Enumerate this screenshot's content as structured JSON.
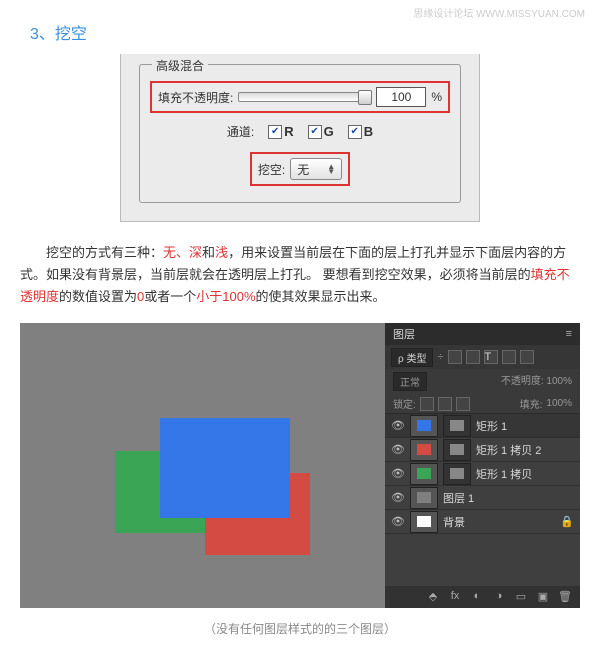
{
  "watermark": "思缘设计论坛  WWW.MISSYUAN.COM",
  "title": "3、挖空",
  "fig1": {
    "legend": "高级混合",
    "fillLabel": "填充不透明度:",
    "fillValue": "100",
    "pct": "%",
    "channelLabel": "通道:",
    "chR": "R",
    "chG": "G",
    "chB": "B",
    "knockoutLabel": "挖空:",
    "knockoutValue": "无"
  },
  "para": {
    "t1": "挖空的方式有三种：",
    "r1": "无、深",
    "t2": "和",
    "r2": "浅",
    "t3": "，用来设置当前层在下面的层上打孔并显示下面层内容的方式。如果没有背景层，当前层就会在透明层上打孔。 要想看到挖空效果，必须将当前层的",
    "r3": "填充不透明度",
    "t4": "的数值设置为",
    "r4": "0",
    "t5": "或者一个",
    "r5": "小于100%",
    "t6": "的使其效果显示出来。"
  },
  "panel": {
    "title": "图层",
    "filter": "ρ 类型",
    "mode": "正常",
    "opacLabel": "不透明度:",
    "opacVal": "100%",
    "lockLabel": "锁定:",
    "fillLabel": "填充:",
    "fillVal": "100%",
    "layers": [
      {
        "name": "矩形 1",
        "c": "#3576e8"
      },
      {
        "name": "矩形 1 拷贝 2",
        "c": "#d34b43"
      },
      {
        "name": "矩形 1 拷贝",
        "c": "#3ba556"
      },
      {
        "name": "图层 1",
        "c": "#808080"
      },
      {
        "name": "背景",
        "c": "#ffffff"
      }
    ]
  },
  "caption": "（没有任何图层样式的的三个图层）"
}
